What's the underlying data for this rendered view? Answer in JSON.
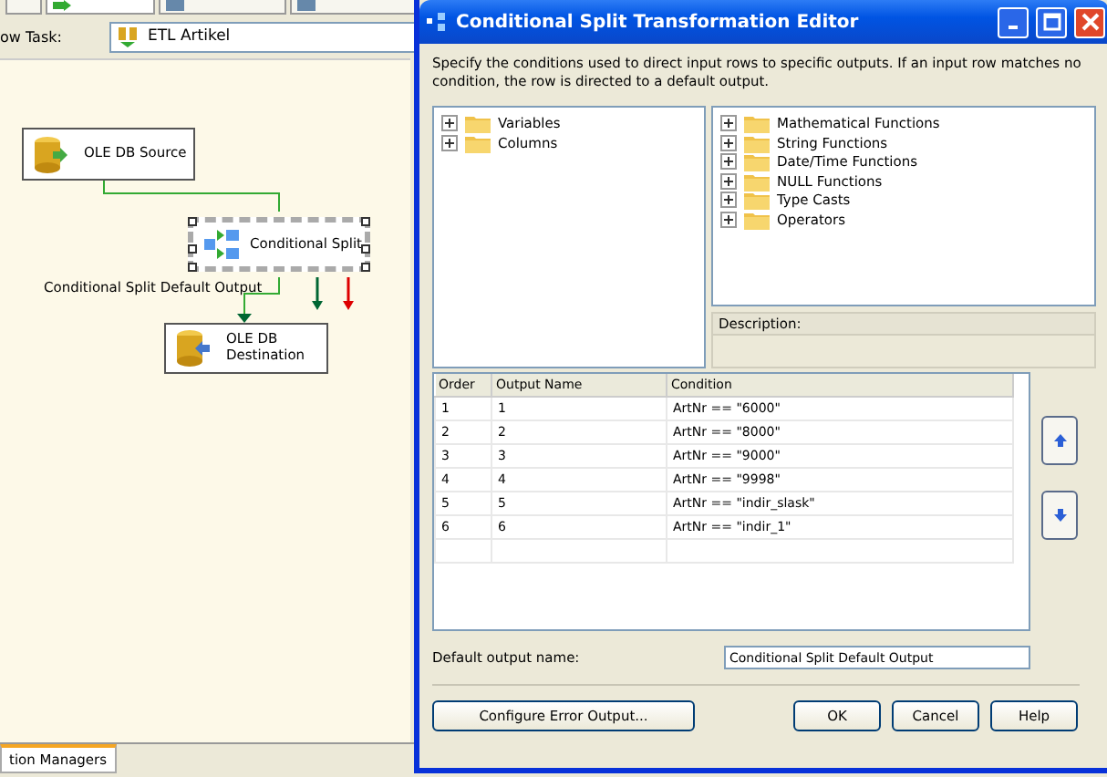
{
  "designer": {
    "tabs": [
      {
        "selected": false
      },
      {
        "selected": true
      },
      {
        "selected": false
      },
      {
        "selected": false
      }
    ],
    "task_label": "ow Task:",
    "task_value": "ETL Artikel",
    "nodes": [
      {
        "kind": "source",
        "label": "OLE DB Source",
        "selected": false
      },
      {
        "kind": "split",
        "label": "Conditional Split",
        "selected": true
      },
      {
        "kind": "destination",
        "label": "OLE DB Destination",
        "selected": false
      }
    ],
    "path_label": "Conditional Split Default Output",
    "bottom_tab": "tion Managers"
  },
  "dialog": {
    "title": "Conditional Split Transformation Editor",
    "intro": "Specify the conditions used to direct input rows to specific outputs. If an input row matches no condition, the row is directed to a default output.",
    "left_tree": [
      {
        "label": "Variables",
        "expanded": false
      },
      {
        "label": "Columns",
        "expanded": false
      }
    ],
    "right_tree": [
      {
        "label": "Mathematical Functions",
        "expanded": false
      },
      {
        "label": "String Functions",
        "expanded": false
      },
      {
        "label": "Date/Time Functions",
        "expanded": false
      },
      {
        "label": "NULL Functions",
        "expanded": false
      },
      {
        "label": "Type Casts",
        "expanded": false
      },
      {
        "label": "Operators",
        "expanded": false
      }
    ],
    "description_label": "Description:",
    "columns": [
      "Order",
      "Output Name",
      "Condition"
    ],
    "rows": [
      {
        "order": "1",
        "name": "1",
        "condition": "ArtNr == \"6000\""
      },
      {
        "order": "2",
        "name": "2",
        "condition": "ArtNr == \"8000\""
      },
      {
        "order": "3",
        "name": "3",
        "condition": "ArtNr == \"9000\""
      },
      {
        "order": "4",
        "name": "4",
        "condition": "ArtNr == \"9998\""
      },
      {
        "order": "5",
        "name": "5",
        "condition": "ArtNr == \"indir_slask\""
      },
      {
        "order": "6",
        "name": "6",
        "condition": "ArtNr == \"indir_1\""
      }
    ],
    "default_output_label": "Default output name:",
    "default_output_value": "Conditional Split Default Output",
    "buttons": [
      {
        "kind": "left",
        "label": "Configure Error Output..."
      },
      {
        "kind": "right",
        "label": "OK"
      },
      {
        "kind": "right",
        "label": "Cancel"
      },
      {
        "kind": "right",
        "label": "Help"
      }
    ]
  }
}
